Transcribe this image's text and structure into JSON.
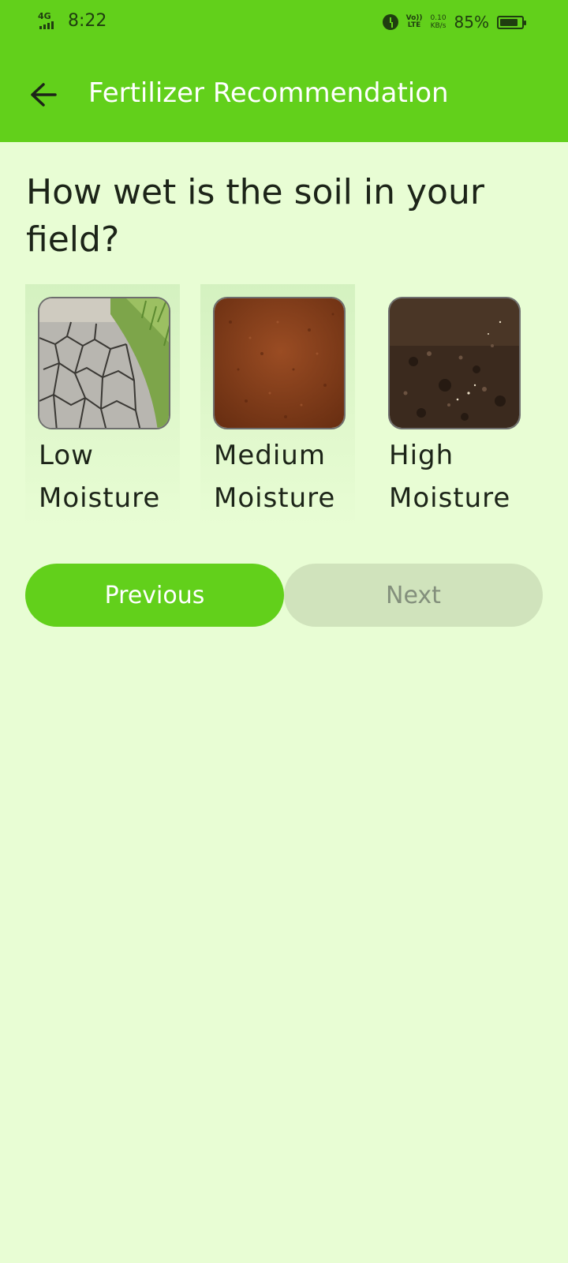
{
  "status_bar": {
    "network": "4G",
    "time": "8:22",
    "volte_top": "Vo))",
    "volte_bottom": "LTE",
    "speed_value": "0.10",
    "speed_unit": "KB/s",
    "battery_percent": "85%",
    "battery_level": 0.85
  },
  "app_bar": {
    "title": "Fertilizer Recommendation"
  },
  "question": "How wet is the soil in your field?",
  "options": [
    {
      "line1": "Low",
      "line2": "Moisture",
      "image": "dry-cracked-soil"
    },
    {
      "line1": "Medium",
      "line2": "Moisture",
      "image": "brown-soil"
    },
    {
      "line1": "High",
      "line2": "Moisture",
      "image": "dark-wet-soil"
    }
  ],
  "buttons": {
    "previous": "Previous",
    "next": "Next"
  },
  "colors": {
    "primary": "#62d01b",
    "background": "#e8fdd4",
    "disabled_button": "#d0e3bc"
  }
}
